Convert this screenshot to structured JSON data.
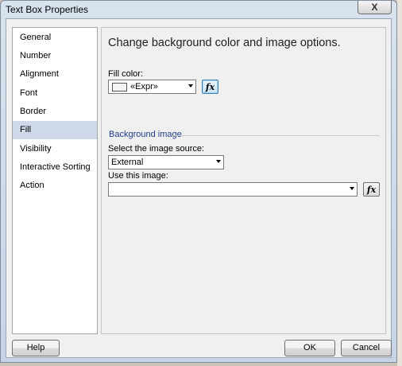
{
  "window": {
    "title": "Text Box Properties",
    "close_glyph": "X"
  },
  "nav": {
    "items": [
      {
        "label": "General"
      },
      {
        "label": "Number"
      },
      {
        "label": "Alignment"
      },
      {
        "label": "Font"
      },
      {
        "label": "Border"
      },
      {
        "label": "Fill",
        "selected": true
      },
      {
        "label": "Visibility"
      },
      {
        "label": "Interactive Sorting"
      },
      {
        "label": "Action"
      }
    ]
  },
  "panel": {
    "heading": "Change background color and image options.",
    "fill_color_label": "Fill color:",
    "fill_color_value": "«Expr»",
    "group_label": "Background image",
    "image_source_label": "Select the image source:",
    "image_source_value": "External",
    "use_image_label": "Use this image:",
    "use_image_value": "",
    "fx_glyph": "fx"
  },
  "footer": {
    "help": "Help",
    "ok": "OK",
    "cancel": "Cancel"
  }
}
